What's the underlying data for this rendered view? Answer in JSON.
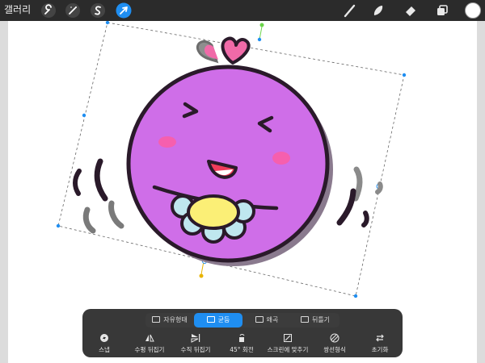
{
  "topbar": {
    "gallery_label": "갤러리",
    "tools_left": [
      {
        "name": "actions",
        "icon": "wrench-icon"
      },
      {
        "name": "adjustments",
        "icon": "magic-wand-icon"
      },
      {
        "name": "selection",
        "icon": "selection-s-icon"
      },
      {
        "name": "transform",
        "icon": "arrow-cursor-icon",
        "active": true
      }
    ],
    "tools_right": [
      {
        "name": "brush",
        "icon": "brush-icon"
      },
      {
        "name": "smudge",
        "icon": "smudge-icon"
      },
      {
        "name": "eraser",
        "icon": "eraser-icon"
      },
      {
        "name": "layers",
        "icon": "layers-icon"
      }
    ],
    "current_color": "#ffffff",
    "accent_color": "#1f8ef1"
  },
  "transform": {
    "modes": [
      {
        "label": "자유형태",
        "icon": "freeform-icon",
        "active": false
      },
      {
        "label": "균등",
        "icon": "uniform-icon",
        "active": true
      },
      {
        "label": "왜곡",
        "icon": "distort-icon",
        "active": false
      },
      {
        "label": "뒤틀기",
        "icon": "warp-icon",
        "active": false
      }
    ],
    "actions": [
      {
        "label": "스냅",
        "icon": "snap-icon"
      },
      {
        "label": "수평 뒤집기",
        "icon": "flip-horizontal-icon"
      },
      {
        "label": "수직 뒤집기",
        "icon": "flip-vertical-icon"
      },
      {
        "label": "45° 회전",
        "icon": "rotate-icon"
      },
      {
        "label": "스크린에 맞추기",
        "icon": "fit-to-screen-icon"
      },
      {
        "label": "쌍선형식",
        "icon": "interpolation-icon"
      },
      {
        "label": "초기화",
        "icon": "reset-icon"
      }
    ]
  },
  "artwork": {
    "face_color": "#cf6ee8",
    "outline_color": "#2a1a2a",
    "shadow_color": "#8a7a8e",
    "selection_handle_color": "#1f8ef1"
  }
}
